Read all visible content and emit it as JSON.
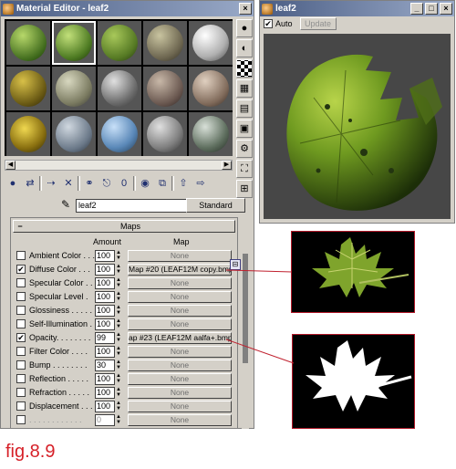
{
  "material_editor": {
    "title": "Material Editor - leaf2",
    "material_name": "leaf2",
    "material_type": "Standard",
    "maps_rollout": {
      "collapse_symbol": "−",
      "title": "Maps",
      "col_amount": "Amount",
      "col_map": "Map",
      "rows": [
        {
          "label": "Ambient Color . . .",
          "checked": false,
          "amount": "100",
          "map": "None"
        },
        {
          "label": "Diffuse Color . . .",
          "checked": true,
          "amount": "100",
          "map": "Map #20 (LEAF12M copy.bmp)"
        },
        {
          "label": "Specular Color . .",
          "checked": false,
          "amount": "100",
          "map": "None"
        },
        {
          "label": "Specular Level .",
          "checked": false,
          "amount": "100",
          "map": "None"
        },
        {
          "label": "Glossiness . . . . .",
          "checked": false,
          "amount": "100",
          "map": "None"
        },
        {
          "label": "Self-Illumination .",
          "checked": false,
          "amount": "100",
          "map": "None"
        },
        {
          "label": "Opacity. . . . . . . .",
          "checked": true,
          "amount": "99",
          "map": "ap #23 (LEAF12M aalfa+.bmp)"
        },
        {
          "label": "Filter Color . . . .",
          "checked": false,
          "amount": "100",
          "map": "None"
        },
        {
          "label": "Bump . . . . . . . .",
          "checked": false,
          "amount": "30",
          "map": "None"
        },
        {
          "label": "Reflection . . . . .",
          "checked": false,
          "amount": "100",
          "map": "None"
        },
        {
          "label": "Refraction . . . . .",
          "checked": false,
          "amount": "100",
          "map": "None"
        },
        {
          "label": "Displacement . . .",
          "checked": false,
          "amount": "100",
          "map": "None"
        },
        {
          "label": ". . . . . . . . . . . .",
          "checked": false,
          "amount": "0",
          "map": "None"
        }
      ]
    }
  },
  "preview": {
    "title": "leaf2",
    "auto_label": "Auto",
    "auto_checked": true,
    "update_label": "Update"
  },
  "caption": "fig.8.9"
}
